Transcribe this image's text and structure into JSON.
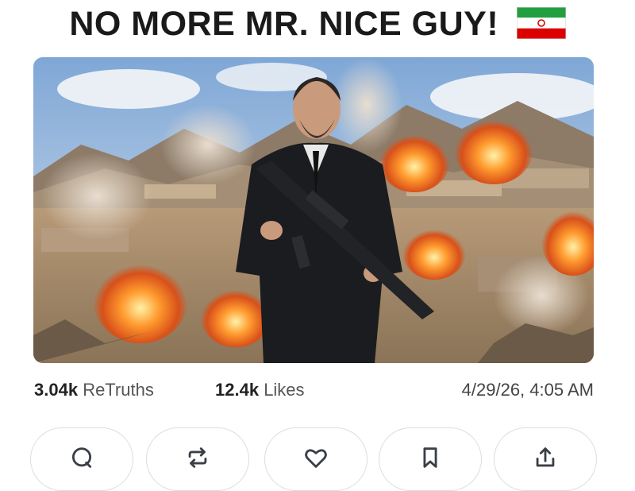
{
  "post": {
    "title": "NO MORE MR. NICE GUY!",
    "flag_icon": "iran-flag-icon"
  },
  "image": {
    "description_icon": "post-image"
  },
  "stats": {
    "retruths_count": "3.04k",
    "retruths_label": "ReTruths",
    "likes_count": "12.4k",
    "likes_label": "Likes",
    "timestamp": "4/29/26, 4:05 AM"
  },
  "actions": [
    {
      "icon": "reply-icon"
    },
    {
      "icon": "retruth-icon"
    },
    {
      "icon": "like-icon"
    },
    {
      "icon": "bookmark-icon"
    },
    {
      "icon": "share-icon"
    }
  ],
  "colors": {
    "flag_green": "#239f40",
    "flag_white": "#ffffff",
    "flag_red": "#da0000",
    "icon_color": "#3a3f47",
    "border": "#dadde2"
  }
}
